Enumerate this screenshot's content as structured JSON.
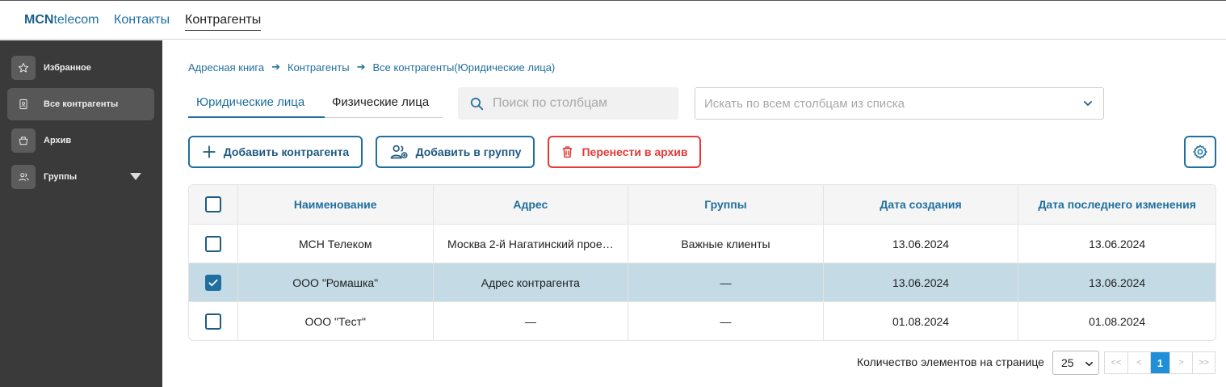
{
  "top_nav": {
    "logo_bold": "MCN",
    "logo_rest": "telecom",
    "links": [
      "Контакты",
      "Контрагенты"
    ]
  },
  "sidebar": {
    "items": [
      {
        "label": "Избранное",
        "icon": "star-icon"
      },
      {
        "label": "Все контрагенты",
        "icon": "contact-card-icon"
      },
      {
        "label": "Архив",
        "icon": "archive-box-icon"
      },
      {
        "label": "Группы",
        "icon": "people-icon"
      }
    ]
  },
  "breadcrumb": [
    "Адресная книга",
    "Контрагенты",
    "Все контрагенты(Юридические лица)"
  ],
  "tabs": [
    "Юридические лица",
    "Физические лица"
  ],
  "search": {
    "placeholder": "Поиск по столбцам"
  },
  "column_filter": {
    "placeholder": "Искать по всем столбцам из списка"
  },
  "toolbar": {
    "add_label": "Добавить контрагента",
    "group_label": "Добавить в группу",
    "archive_label": "Перенести в архив"
  },
  "table": {
    "columns": [
      "Наименование",
      "Адрес",
      "Группы",
      "Дата создания",
      "Дата последнего изменения"
    ],
    "rows": [
      {
        "checked": false,
        "cells": [
          "МСН Телеком",
          "Москва 2-й Нагатинский прое…",
          "Важные клиенты",
          "13.06.2024",
          "13.06.2024"
        ]
      },
      {
        "checked": true,
        "cells": [
          "ООО \"Ромашка\"",
          "Адрес контрагента",
          "—",
          "13.06.2024",
          "13.06.2024"
        ]
      },
      {
        "checked": false,
        "cells": [
          "ООО \"Тест\"",
          "—",
          "—",
          "01.08.2024",
          "01.08.2024"
        ]
      }
    ]
  },
  "pagination": {
    "label": "Количество элементов на странице",
    "page_size": "25",
    "first": "<<",
    "prev": "<",
    "current": "1",
    "next": ">",
    "last": ">>"
  },
  "colors": {
    "accent": "#1f6fa0",
    "danger": "#e53935",
    "selected_row": "#c4dbe6",
    "sidebar_bg": "#3a3a3a",
    "active_page": "#1e8fd8"
  }
}
